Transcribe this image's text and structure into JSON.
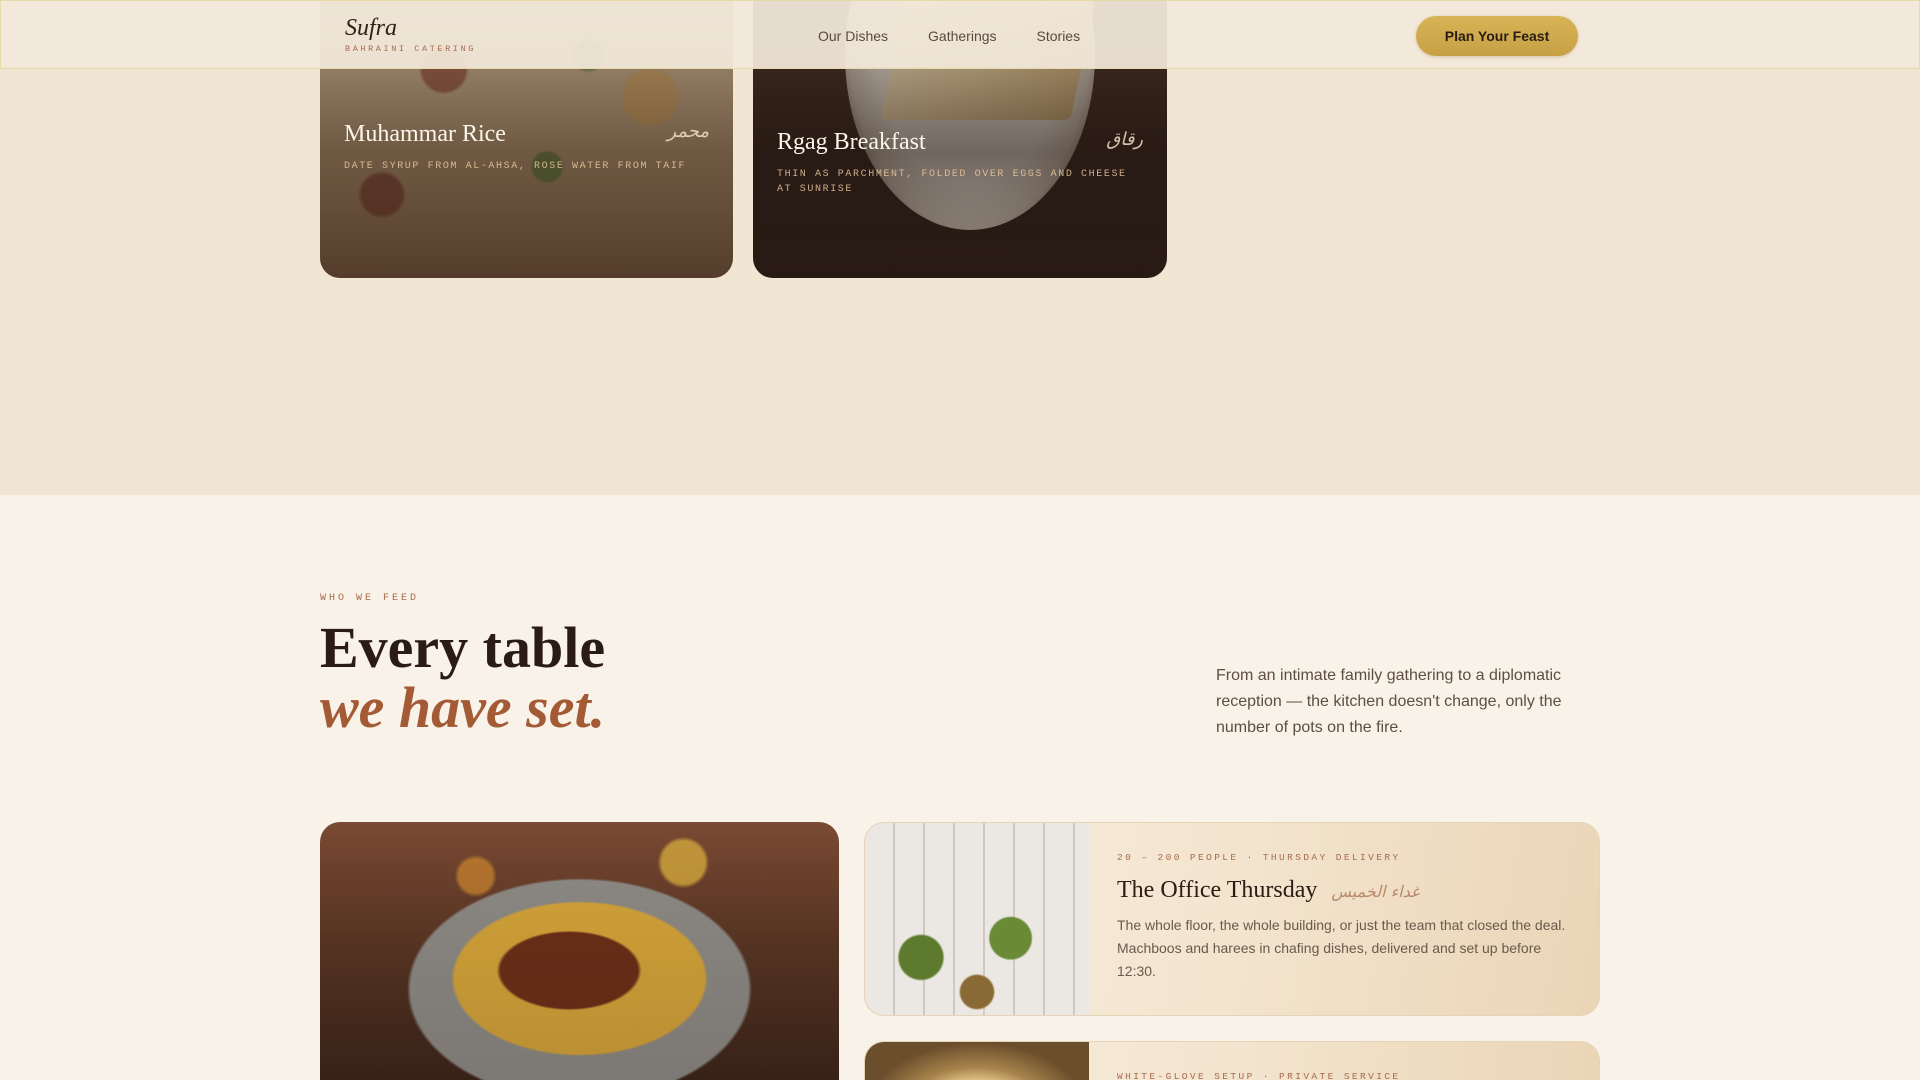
{
  "header": {
    "logo_name": "Sufra",
    "logo_tagline": "BAHRAINI CATERING",
    "nav": [
      "Our Dishes",
      "Gatherings",
      "Stories"
    ],
    "cta_label": "Plan Your Feast"
  },
  "dishes": [
    {
      "name": "Muhammar Rice",
      "arabic": "محمر",
      "description": "DATE SYRUP FROM AL-AHSA, ROSE WATER FROM TAIF"
    },
    {
      "name": "Rgag Breakfast",
      "arabic": "رقاق",
      "description": "THIN AS PARCHMENT, FOLDED OVER EGGS AND CHEESE AT SUNRISE"
    }
  ],
  "who_we_feed": {
    "eyebrow": "WHO WE FEED",
    "headline_line1": "Every table",
    "headline_line2": "we have set.",
    "intro": "From an intimate family gathering to a diplomatic reception — the kitchen doesn't change, only the number of pots on the fire."
  },
  "occasions": [
    {
      "meta": "20 – 200 PEOPLE · THURSDAY DELIVERY",
      "title": "The Office Thursday",
      "arabic": "غداء الخميس",
      "description": "The whole floor, the whole building, or just the team that closed the deal. Machboos and harees in chafing dishes, delivered and set up before 12:30."
    },
    {
      "meta": "WHITE-GLOVE SETUP · PRIVATE SERVICE"
    }
  ],
  "colors": {
    "accent_gold": "#d1ad50",
    "accent_terracotta": "#a35a35",
    "ink": "#2a1c14",
    "band": "#f1e5d4",
    "page": "#f8f2e9"
  }
}
